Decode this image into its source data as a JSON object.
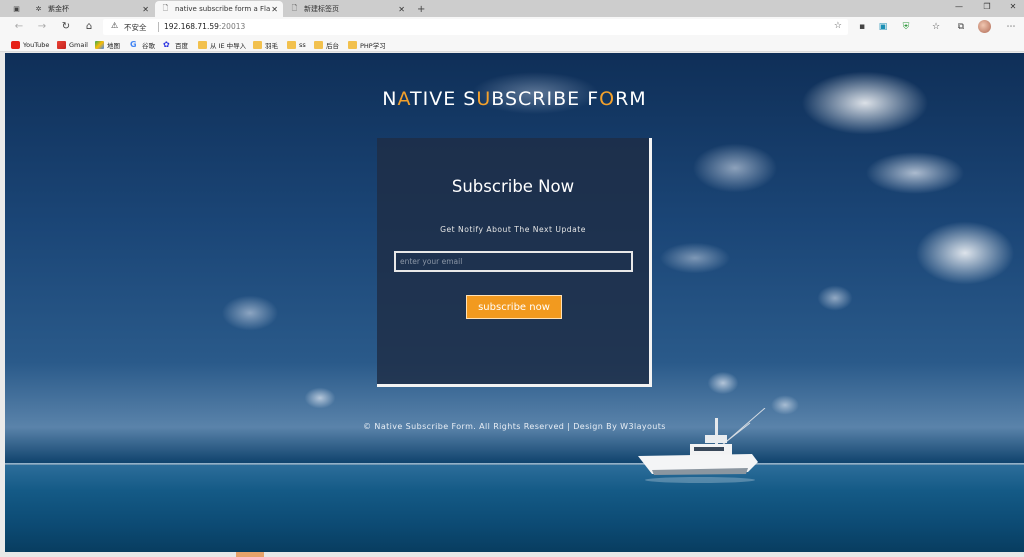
{
  "tabs": [
    {
      "title": "紫金杯",
      "active": false
    },
    {
      "title": "native subscribe form a Flat Resp",
      "active": true
    },
    {
      "title": "新建标签页",
      "active": false
    }
  ],
  "address": {
    "insecure_label": "不安全",
    "host": "192.168.71.59",
    "port": ":20013"
  },
  "bookmarks": [
    {
      "label": "YouTube",
      "icon": "youtube-icon"
    },
    {
      "label": "Gmail",
      "icon": "gmail-icon"
    },
    {
      "label": "地图",
      "icon": "maps-icon"
    },
    {
      "label": "谷歌",
      "icon": "google-icon"
    },
    {
      "label": "百度",
      "icon": "baidu-icon"
    },
    {
      "label": "从 IE 中导入",
      "icon": "folder-icon"
    },
    {
      "label": "羽毛",
      "icon": "folder-icon"
    },
    {
      "label": "ss",
      "icon": "folder-icon"
    },
    {
      "label": "后台",
      "icon": "folder-icon"
    },
    {
      "label": "PHP学习",
      "icon": "folder-icon"
    }
  ],
  "page": {
    "title_parts": [
      {
        "text": "N",
        "accent": false
      },
      {
        "text": "A",
        "accent": true
      },
      {
        "text": "TIVE S",
        "accent": false
      },
      {
        "text": "U",
        "accent": true
      },
      {
        "text": "BSCRIBE F",
        "accent": false
      },
      {
        "text": "O",
        "accent": true
      },
      {
        "text": "RM",
        "accent": false
      }
    ],
    "accent_color": "#f4a12b"
  },
  "card": {
    "title": "Subscribe Now",
    "subtitle": "Get Notify About The Next Update",
    "email_placeholder": "enter your email",
    "email_value": "",
    "button_label": "subscribe now",
    "button_color": "#f29a1f"
  },
  "footer": {
    "text": "© Native Subscribe Form. All Rights Reserved | Design By W3layouts"
  }
}
